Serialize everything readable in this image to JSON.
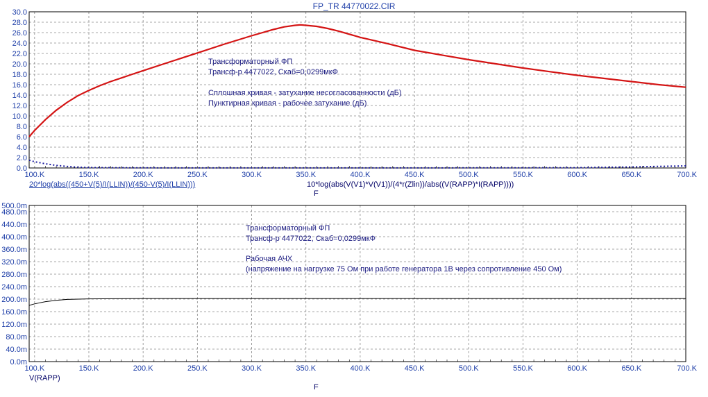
{
  "title": "FP_TR 44770022.CIR",
  "top_panel": {
    "expr1": "20*log(abs((450+V(5)/I(LLIN))/(450-V(5)/I(LLIN)))",
    "expr2": "10*log(abs(V(V1)*V(V1))/(4*r(Zlin))/abs((V(RAPP)*I(RAPP))))",
    "xvar": "F",
    "notes": [
      "Трансформаторный ФП",
      "Трансф-р 4477022, Скаб=0,0299мкФ",
      "Сплошная кривая - затухание несогласованности (дБ)",
      "Пунктирная кривая - рабочее затухание (дБ)"
    ]
  },
  "bottom_panel": {
    "expr1": "V(RAPP)",
    "xvar": "F",
    "notes": [
      "Трансформаторный ФП",
      "Трансф-р 4477022, Скаб=0,0299мкФ",
      "Рабочая АЧХ",
      "(напряжение на нагрузке 75 Ом при работе генератора 1В через сопротивление 450 Ом)"
    ]
  },
  "colors": {
    "solid": "#d41414",
    "dotted": "#1c1ca0",
    "vrapp": "#000000",
    "axis_text": "#1f3fa8",
    "grid": "#8a8a8a"
  },
  "chart_data": [
    {
      "type": "line",
      "xlim": [
        95000,
        700000
      ],
      "ylim": [
        0,
        30
      ],
      "x_ticks": [
        "100.K",
        "150.K",
        "200.K",
        "250.K",
        "300.K",
        "350.K",
        "400.K",
        "450.K",
        "500.K",
        "550.K",
        "600.K",
        "650.K",
        "700.K"
      ],
      "y_ticks": [
        "0.0",
        "2.0",
        "4.0",
        "6.0",
        "8.0",
        "10.0",
        "12.0",
        "14.0",
        "16.0",
        "18.0",
        "20.0",
        "22.0",
        "24.0",
        "26.0",
        "28.0",
        "30.0"
      ],
      "grid": true,
      "series": [
        {
          "style": "solid",
          "x": [
            95000,
            100000,
            110000,
            120000,
            130000,
            140000,
            150000,
            160000,
            170000,
            180000,
            190000,
            200000,
            225000,
            250000,
            275000,
            300000,
            310000,
            320000,
            330000,
            340000,
            345000,
            350000,
            360000,
            370000,
            380000,
            400000,
            425000,
            450000,
            475000,
            500000,
            525000,
            550000,
            575000,
            600000,
            625000,
            650000,
            675000,
            700000
          ],
          "values": [
            6.0,
            7.2,
            9.3,
            11.1,
            12.6,
            13.9,
            14.9,
            15.8,
            16.6,
            17.3,
            18.0,
            18.7,
            20.4,
            22.1,
            23.8,
            25.4,
            26.0,
            26.6,
            27.1,
            27.4,
            27.5,
            27.4,
            27.2,
            26.8,
            26.3,
            25.1,
            23.9,
            22.6,
            21.7,
            20.8,
            20.0,
            19.2,
            18.5,
            17.8,
            17.2,
            16.6,
            16.0,
            15.5
          ]
        },
        {
          "style": "dotted",
          "x": [
            95000,
            100000,
            110000,
            120000,
            130000,
            140000,
            150000,
            200000,
            300000,
            400000,
            500000,
            600000,
            650000,
            700000
          ],
          "values": [
            1.5,
            1.2,
            0.8,
            0.5,
            0.3,
            0.15,
            0.08,
            0.02,
            0.01,
            0.01,
            0.02,
            0.05,
            0.2,
            0.4
          ]
        }
      ]
    },
    {
      "type": "line",
      "xlim": [
        95000,
        700000
      ],
      "ylim": [
        0,
        500
      ],
      "x_ticks": [
        "100.K",
        "150.K",
        "200.K",
        "250.K",
        "300.K",
        "350.K",
        "400.K",
        "450.K",
        "500.K",
        "550.K",
        "600.K",
        "650.K",
        "700.K"
      ],
      "y_ticks": [
        "0.0m",
        "40.0m",
        "80.0m",
        "120.0m",
        "160.0m",
        "200.0m",
        "240.0m",
        "280.0m",
        "320.0m",
        "360.0m",
        "400.0m",
        "440.0m",
        "480.0m",
        "500.0m"
      ],
      "grid": true,
      "series": [
        {
          "style": "solid",
          "x": [
            95000,
            100000,
            110000,
            120000,
            130000,
            140000,
            150000,
            200000,
            300000,
            400000,
            500000,
            600000,
            700000
          ],
          "values": [
            180,
            185,
            192,
            196,
            199,
            200,
            201,
            202,
            202,
            202,
            202,
            202,
            202
          ]
        }
      ]
    }
  ]
}
